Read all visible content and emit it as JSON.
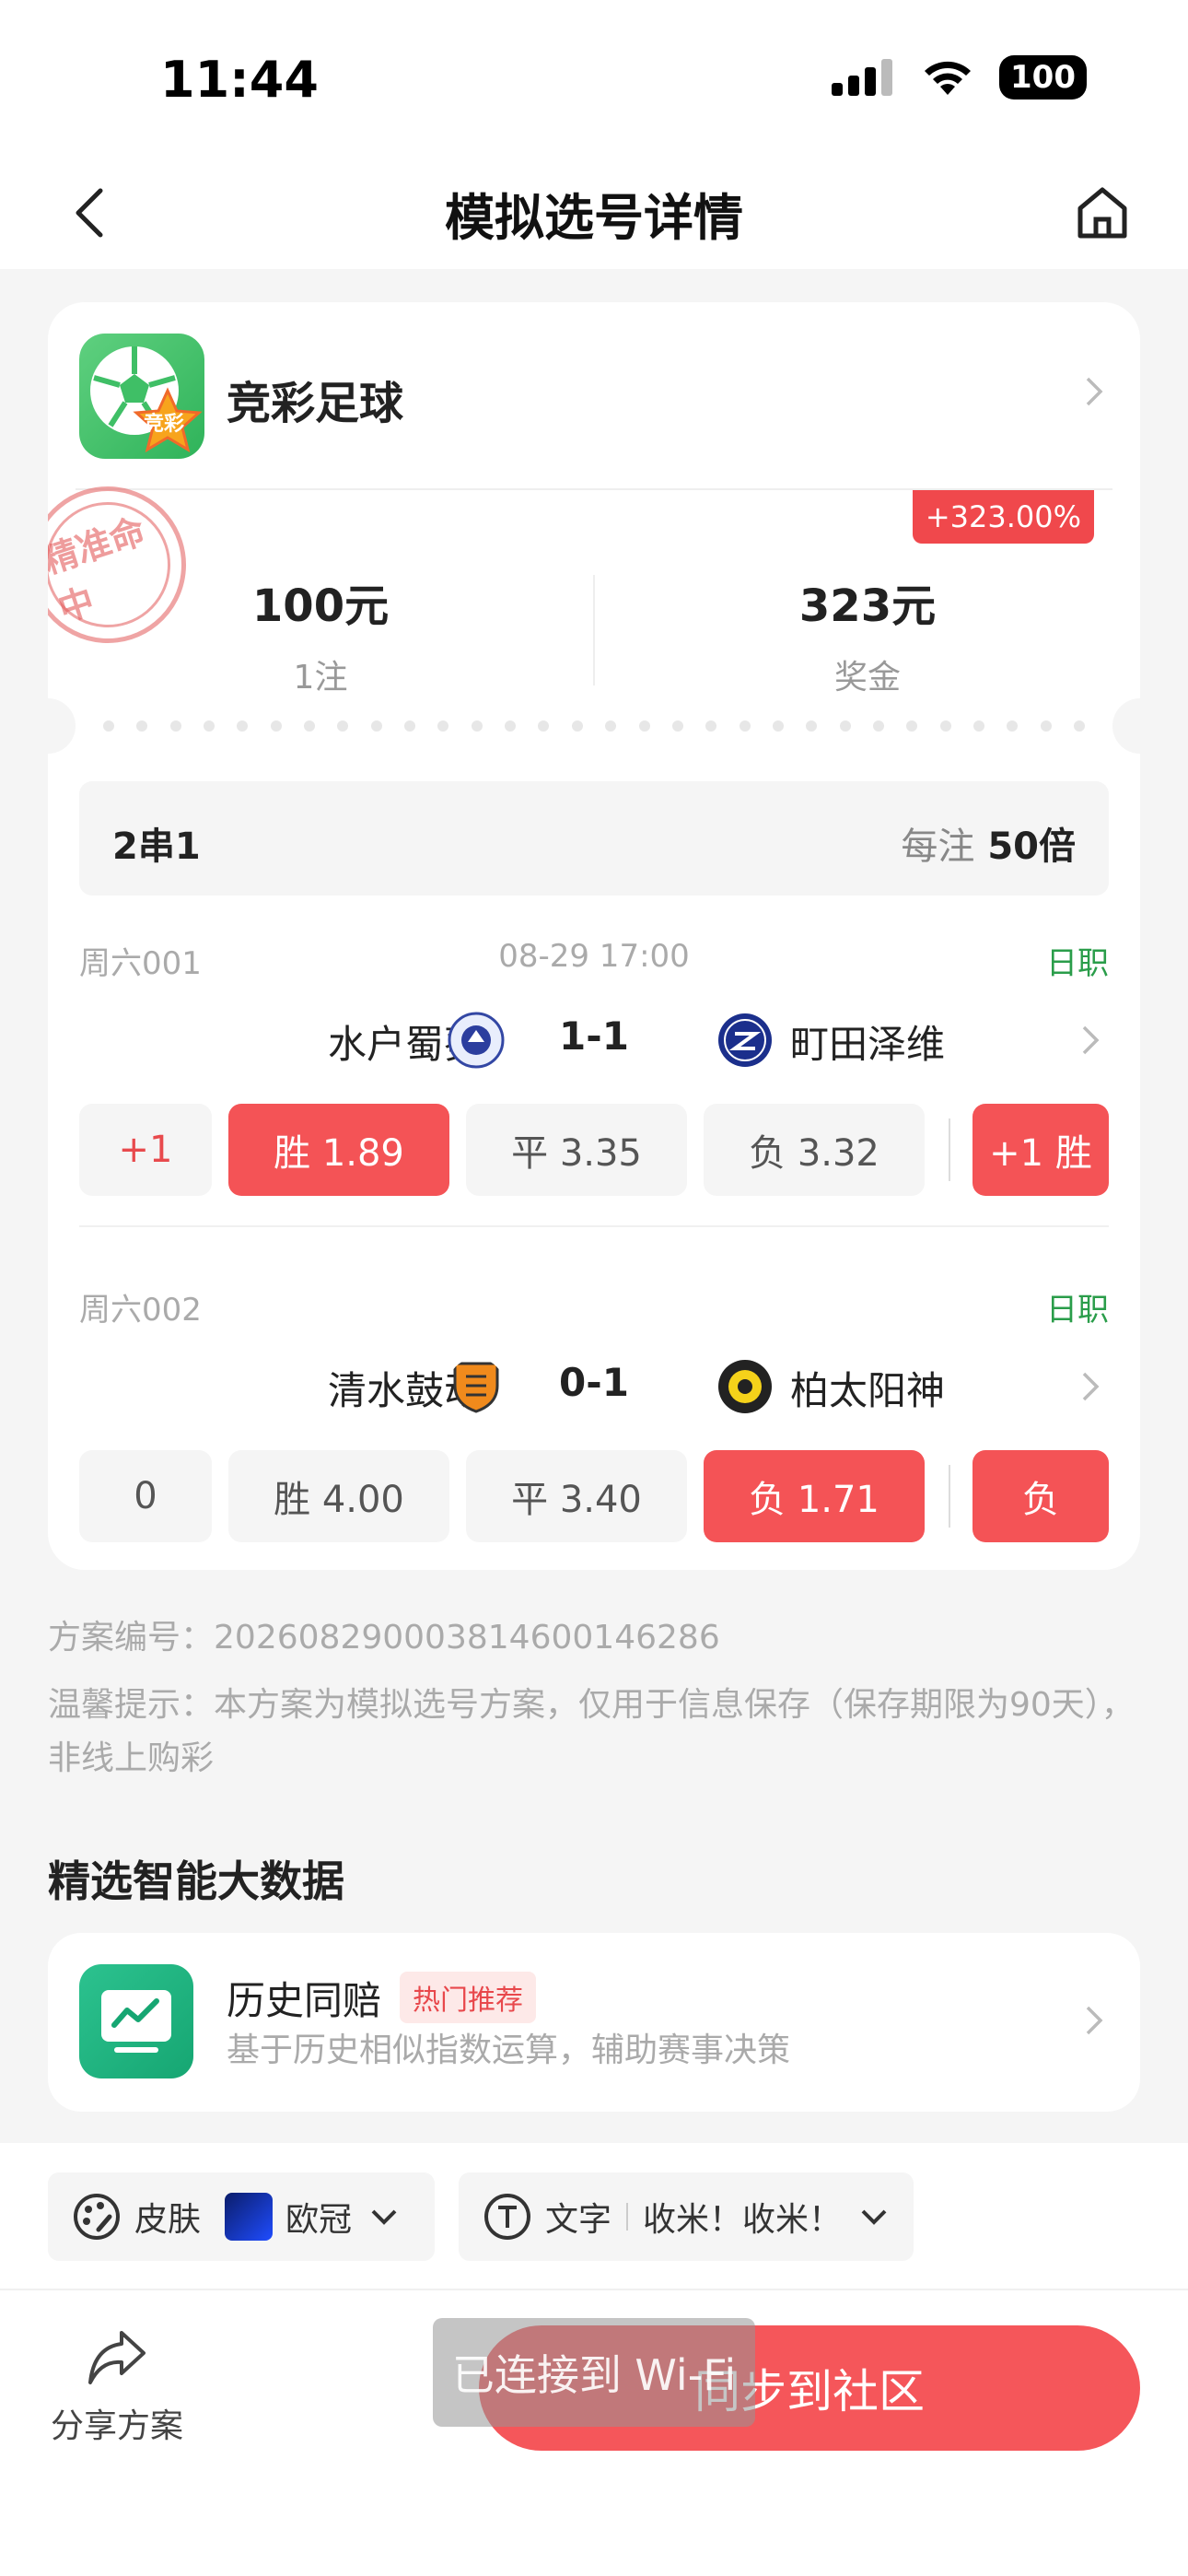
{
  "status": {
    "time": "11:44",
    "battery": "100"
  },
  "nav": {
    "title": "模拟选号详情"
  },
  "lottery": {
    "name": "竞彩足球",
    "logo_text": "竞彩"
  },
  "stamp": {
    "text": "精准命中"
  },
  "summary": {
    "profit_badge": "+323.00%",
    "stake_value": "100元",
    "stake_label": "1注",
    "prize_value": "323元",
    "prize_label": "奖金"
  },
  "combo": {
    "type": "2串1",
    "multiplier_label": "每注",
    "multiplier_value": "50倍"
  },
  "matches": [
    {
      "code": "周六001",
      "time": "08-29 17:00",
      "league": "日职",
      "home": "水户蜀葵",
      "score": "1-1",
      "away": "町田泽维",
      "handicap": "+1",
      "win": "胜 1.89",
      "draw": "平 3.35",
      "lose": "负 3.32",
      "result": "+1 胜"
    },
    {
      "code": "周六002",
      "time": "",
      "league": "日职",
      "home": "清水鼓动",
      "score": "0-1",
      "away": "柏太阳神",
      "handicap": "0",
      "win": "胜 4.00",
      "draw": "平 3.40",
      "lose": "负 1.71",
      "result": "负"
    }
  ],
  "plan": {
    "id_label": "方案编号：",
    "id_value": "202608290003814600146286"
  },
  "tip": {
    "text": "温馨提示：本方案为模拟选号方案，仅用于信息保存（保存期限为90天），非线上购彩"
  },
  "section": {
    "title": "精选智能大数据"
  },
  "feature": {
    "title": "历史同赔",
    "tag": "热门推荐",
    "desc": "基于历史相似指数运算，辅助赛事决策"
  },
  "bottom": {
    "skin_label": "皮肤",
    "skin_value": "欧冠",
    "text_label": "文字",
    "text_value": "收米！收米！",
    "share_label": "分享方案",
    "wifi_toast": "已连接到 Wi-Fi",
    "sync_label": "同步到社区"
  },
  "colors": {
    "accent_red": "#f45356",
    "league_green": "#2a9d4a"
  }
}
